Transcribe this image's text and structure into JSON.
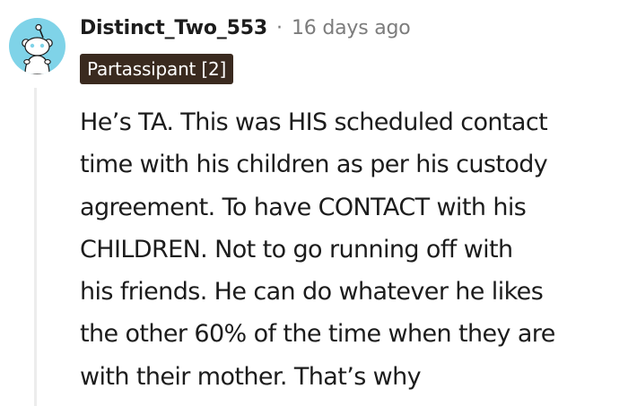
{
  "comment": {
    "username": "Distinct_Two_553",
    "separator": "·",
    "timestamp": "16 days ago",
    "flair": "Partassipant [2]",
    "avatar_icon": "reddit-snoo-avatar",
    "lines": [
      "He’s TA. This was HIS scheduled contact",
      "time with his children as per his custody",
      "agreement. To have CONTACT with his",
      "CHILDREN. Not to go running off with",
      "his friends. He can do whatever he likes",
      "the other 60% of the time when they are",
      "with their mother. That’s why"
    ]
  },
  "colors": {
    "avatar_bg": "#7fd3e8",
    "flair_bg": "#3a2a1f",
    "text": "#1c1c1c",
    "meta": "#7c7c7c",
    "thread_line": "#ececec"
  }
}
